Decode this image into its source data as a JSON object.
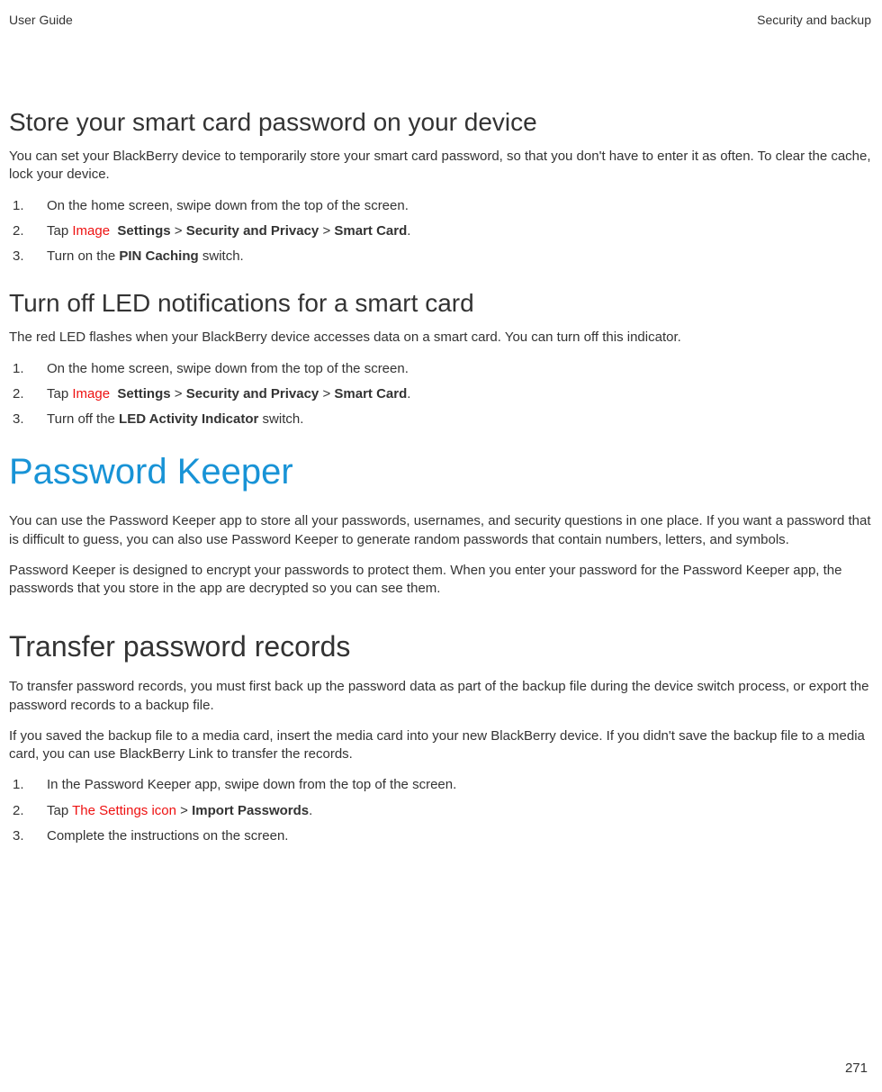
{
  "header": {
    "left": "User Guide",
    "right": "Security and backup"
  },
  "section1": {
    "title": "Store your smart card password on your device",
    "intro": "You can set your BlackBerry device to temporarily store your smart card password, so that you don't have to enter it as often. To clear the cache, lock your device.",
    "steps": {
      "n1": "1.",
      "t1": "On the home screen, swipe down from the top of the screen.",
      "n2": "2.",
      "t2a": "Tap ",
      "t2img": "Image",
      "t2b": "Settings",
      "t2gt1": " > ",
      "t2c": "Security and Privacy",
      "t2gt2": " > ",
      "t2d": "Smart Card",
      "t2e": ".",
      "n3": "3.",
      "t3a": "Turn on the ",
      "t3b": "PIN Caching",
      "t3c": " switch."
    }
  },
  "section2": {
    "title": "Turn off LED notifications for a smart card",
    "intro": "The red LED flashes when your BlackBerry device accesses data on a smart card. You can turn off this indicator.",
    "steps": {
      "n1": "1.",
      "t1": "On the home screen, swipe down from the top of the screen.",
      "n2": "2.",
      "t2a": "Tap ",
      "t2img": "Image",
      "t2b": "Settings",
      "t2gt1": " > ",
      "t2c": "Security and Privacy",
      "t2gt2": " > ",
      "t2d": "Smart Card",
      "t2e": ".",
      "n3": "3.",
      "t3a": "Turn off the ",
      "t3b": "LED Activity Indicator",
      "t3c": " switch."
    }
  },
  "section3": {
    "title": "Password Keeper",
    "p1": "You can use the Password Keeper app to store all your passwords, usernames, and security questions in one place. If you want a password that is difficult to guess, you can also use Password Keeper to generate random passwords that contain numbers, letters, and symbols.",
    "p2": "Password Keeper is designed to encrypt your passwords to protect them. When you enter your password for the Password Keeper app, the passwords that you store in the app are decrypted so you can see them."
  },
  "section4": {
    "title": "Transfer password records",
    "p1": "To transfer password records, you must first back up the password data as part of the backup file during the device switch process, or export the password records to a backup file.",
    "p2": "If you saved the backup file to a media card, insert the media card into your new BlackBerry device. If you didn't save the backup file to a media card, you can use BlackBerry Link to transfer the records.",
    "steps": {
      "n1": "1.",
      "t1": "In the Password Keeper app, swipe down from the top of the screen.",
      "n2": "2.",
      "t2a": "Tap ",
      "t2img": "The Settings icon",
      "t2gt": " > ",
      "t2b": "Import Passwords",
      "t2c": ".",
      "n3": "3.",
      "t3": "Complete the instructions on the screen."
    }
  },
  "page_number": "271"
}
